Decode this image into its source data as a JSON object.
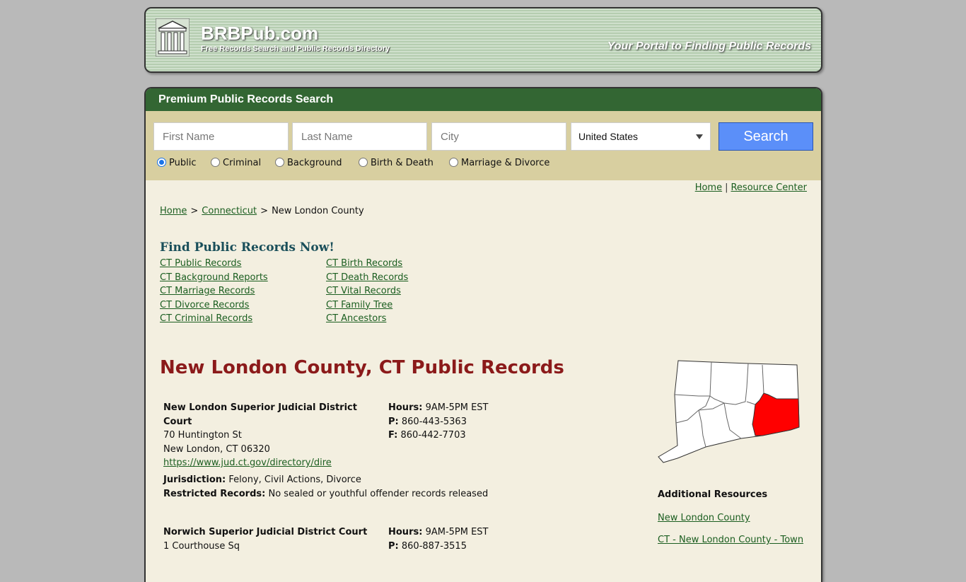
{
  "header": {
    "site_name": "BRBPub.com",
    "tagline": "Free Records Search and Public Records Directory",
    "portal": "Your Portal to Finding Public Records"
  },
  "search": {
    "heading": "Premium Public Records Search",
    "first_name_placeholder": "First Name",
    "last_name_placeholder": "Last Name",
    "city_placeholder": "City",
    "country_selected": "United States",
    "button_label": "Search",
    "radios": [
      "Public",
      "Criminal",
      "Background",
      "Birth & Death",
      "Marriage & Divorce"
    ],
    "selected_radio": "Public"
  },
  "toplinks": {
    "home": "Home",
    "separator": "|",
    "resource_center": "Resource Center"
  },
  "breadcrumb": {
    "home": "Home",
    "state": "Connecticut",
    "current": "New London County",
    "separator": ">"
  },
  "find": {
    "title": "Find Public Records Now!",
    "left": [
      "CT Public Records",
      "CT Background Reports",
      "CT Marriage Records",
      "CT Divorce Records",
      "CT Criminal Records"
    ],
    "right": [
      "CT Birth Records",
      "CT Death Records",
      "CT Vital Records",
      "CT Family Tree",
      "CT Ancestors"
    ]
  },
  "county_title": "New London County, CT Public Records",
  "courts": [
    {
      "name": "New London Superior Judicial District Court",
      "address1": "70 Huntington St",
      "address2": "New London, CT 06320",
      "url": "https://www.jud.ct.gov/directory/dire",
      "hours_label": "Hours:",
      "hours": "9AM-5PM EST",
      "phone_label": "P:",
      "phone": "860-443-5363",
      "fax_label": "F:",
      "fax": "860-442-7703",
      "jurisdiction_label": "Jurisdiction:",
      "jurisdiction": "Felony, Civil Actions, Divorce",
      "restricted_label": "Restricted Records:",
      "restricted": "No sealed or youthful offender records released"
    },
    {
      "name": "Norwich Superior Judicial District Court",
      "address1": "1 Courthouse Sq",
      "hours_label": "Hours:",
      "hours": "9AM-5PM EST",
      "phone_label": "P:",
      "phone": "860-887-3515"
    }
  ],
  "sidebar": {
    "additional_title": "Additional Resources",
    "links": [
      "New London County",
      "CT - New London County - Town"
    ]
  },
  "colors": {
    "background": "#b9b9b9",
    "search_header": "#336633",
    "search_area": "#d8cfa0",
    "panel": "#f3efe0",
    "title_red": "#8b1a1a",
    "link_green": "#1b5e20",
    "search_button": "#5b8ff9",
    "map_highlight": "#ff0000"
  }
}
